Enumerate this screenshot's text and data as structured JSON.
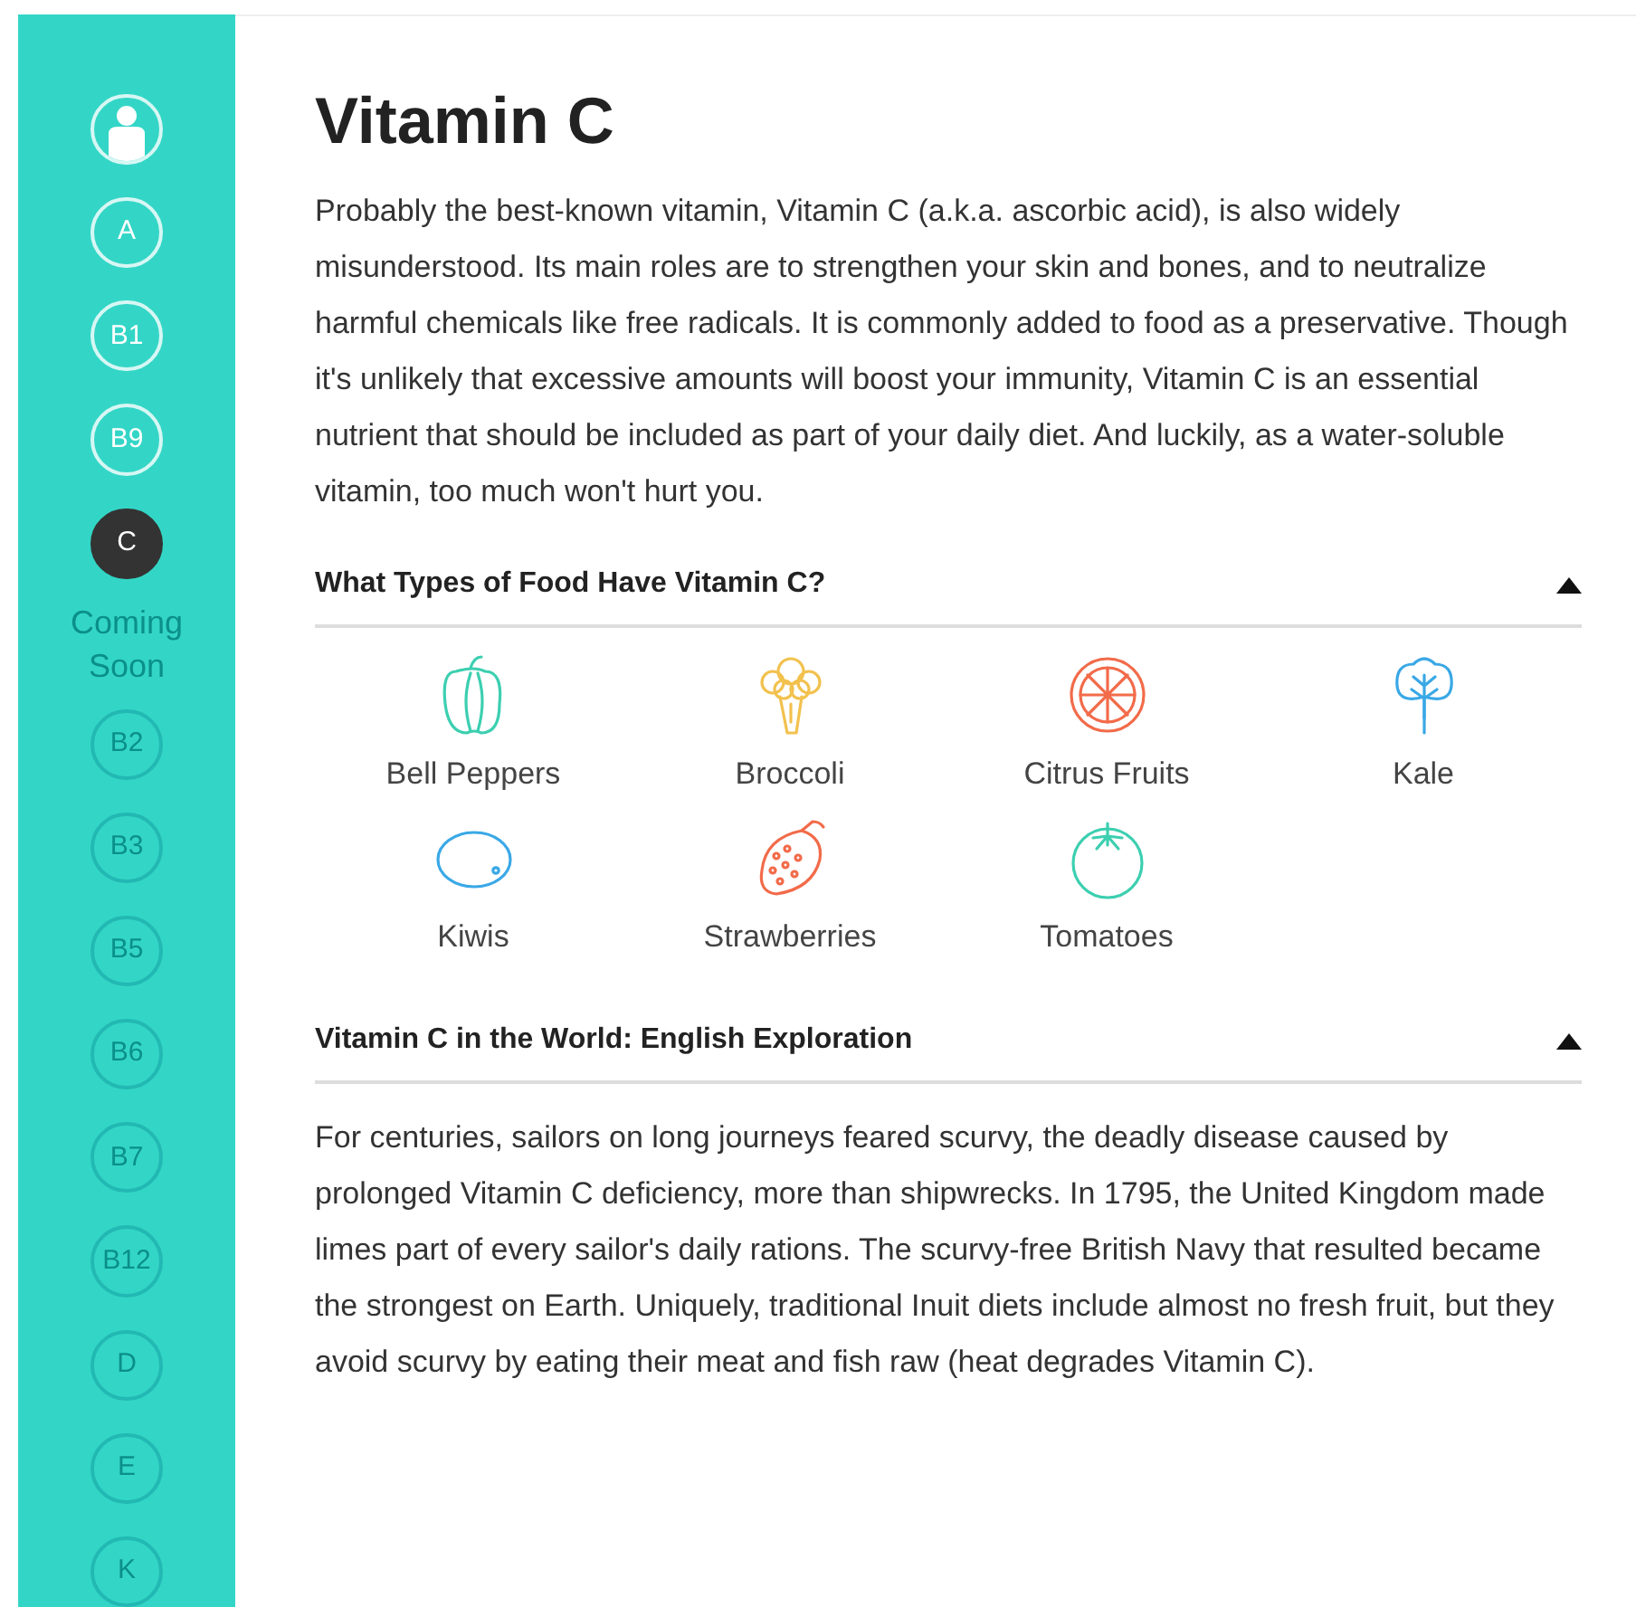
{
  "sidebar": {
    "items": [
      {
        "kind": "profile",
        "selected": false,
        "disabled": false
      },
      {
        "kind": "vitamin",
        "label": "A",
        "selected": false,
        "disabled": false
      },
      {
        "kind": "vitamin",
        "label": "B1",
        "selected": false,
        "disabled": false
      },
      {
        "kind": "vitamin",
        "label": "B9",
        "selected": false,
        "disabled": false
      },
      {
        "kind": "vitamin",
        "label": "C",
        "selected": true,
        "disabled": false
      },
      {
        "kind": "note",
        "label": "Coming Soon"
      },
      {
        "kind": "vitamin",
        "label": "B2",
        "selected": false,
        "disabled": true
      },
      {
        "kind": "vitamin",
        "label": "B3",
        "selected": false,
        "disabled": true
      },
      {
        "kind": "vitamin",
        "label": "B5",
        "selected": false,
        "disabled": true
      },
      {
        "kind": "vitamin",
        "label": "B6",
        "selected": false,
        "disabled": true
      },
      {
        "kind": "vitamin",
        "label": "B7",
        "selected": false,
        "disabled": true
      },
      {
        "kind": "vitamin",
        "label": "B12",
        "selected": false,
        "disabled": true
      },
      {
        "kind": "vitamin",
        "label": "D",
        "selected": false,
        "disabled": true
      },
      {
        "kind": "vitamin",
        "label": "E",
        "selected": false,
        "disabled": true
      },
      {
        "kind": "vitamin",
        "label": "K",
        "selected": false,
        "disabled": true
      }
    ]
  },
  "title": "Vitamin C",
  "intro": "Probably the best-known vitamin, Vitamin C (a.k.a. ascorbic acid), is also widely misunderstood. Its main roles are to strengthen your skin and bones, and to neutralize harmful chemicals like free radicals. It is commonly added to food as a preservative. Though it's unlikely that excessive amounts will boost your immunity, Vitamin C is an essential nutrient that should be included as part of your daily diet. And luckily, as a water-soluble vitamin, too much won't hurt you.",
  "sections": [
    {
      "kind": "foods",
      "heading": "What Types of Food Have Vitamin C?",
      "expanded": true,
      "foods": [
        {
          "kind": "pepper",
          "label": "Bell Peppers",
          "color": "#3ccfb0"
        },
        {
          "kind": "broccoli",
          "label": "Broccoli",
          "color": "#f2c14e"
        },
        {
          "kind": "citrus",
          "label": "Citrus Fruits",
          "color": "#f26b4a"
        },
        {
          "kind": "leaf",
          "label": "Kale",
          "color": "#3aa8e6"
        },
        {
          "kind": "kiwi",
          "label": "Kiwis",
          "color": "#3aa8e6"
        },
        {
          "kind": "strawberry",
          "label": "Strawberries",
          "color": "#f26b4a"
        },
        {
          "kind": "tomato",
          "label": "Tomatoes",
          "color": "#3ccfb0"
        }
      ]
    },
    {
      "kind": "text",
      "heading": "Vitamin C in the World: English Exploration",
      "expanded": true,
      "text": "For centuries, sailors on long journeys feared scurvy, the deadly disease caused by prolonged Vitamin C deficiency, more than shipwrecks. In 1795, the United Kingdom made limes part of every sailor's daily rations. The scurvy-free British Navy that resulted became the strongest on Earth. Uniquely, traditional Inuit diets include almost no fresh fruit, but they avoid scurvy by eating their meat and fish raw (heat degrades Vitamin C)."
    }
  ]
}
